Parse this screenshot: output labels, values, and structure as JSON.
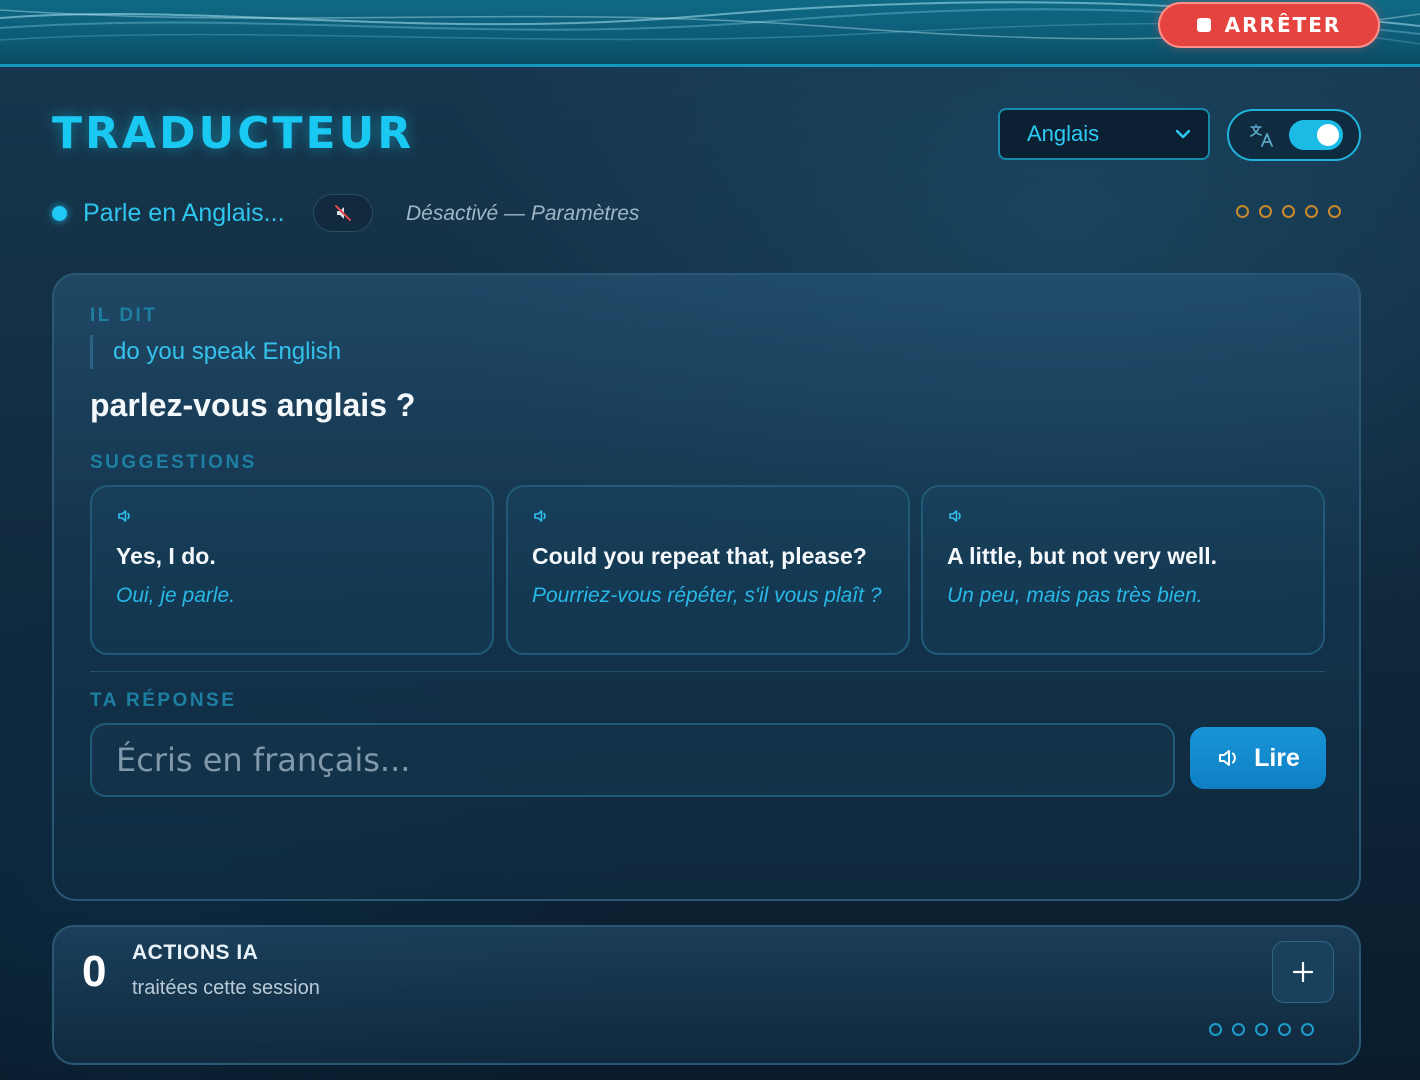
{
  "top_bar": {
    "stop_label": "ARRÊTER",
    "stop_color": "#e4433f",
    "stop_icon": "stop-square-icon"
  },
  "header": {
    "title": "TRADUCTEUR",
    "language_select": {
      "value": "Anglais"
    },
    "translate_toggle": {
      "icon": "translate-icon",
      "on": true
    }
  },
  "status": {
    "text": "Parle en Anglais...",
    "mute_icon": "speaker-muted-icon",
    "settings_text": "Désactivé — Paramètres",
    "dots_count": 5,
    "dots_color": "#c88a2a"
  },
  "conversation": {
    "heard_label": "IL DIT",
    "source_text": "do you speak English",
    "translation": "parlez-vous anglais ?",
    "suggestions_label": "SUGGESTIONS",
    "suggestions": [
      {
        "en": "Yes, I do.",
        "fr": "Oui, je parle.",
        "icon": "speaker-icon"
      },
      {
        "en": "Could you repeat that, please?",
        "fr": "Pourriez-vous répéter, s'il vous plaît ?",
        "icon": "speaker-icon"
      },
      {
        "en": "A little, but not very well.",
        "fr": "Un peu, mais pas très bien.",
        "icon": "speaker-icon"
      }
    ],
    "answer_label": "TA RÉPONSE",
    "answer_placeholder": "Écris en français...",
    "answer_value": "",
    "read_button": "Lire"
  },
  "stats": {
    "count": "0",
    "title": "ACTIONS IA",
    "subtitle": "traitées cette session",
    "add_icon": "plus-icon",
    "dots_count": 5,
    "dots_color": "#1d9ccb"
  },
  "colors": {
    "accent": "#19c9f2",
    "background": "#122d42",
    "danger": "#e4433f",
    "primary_button": "#1896d8"
  }
}
